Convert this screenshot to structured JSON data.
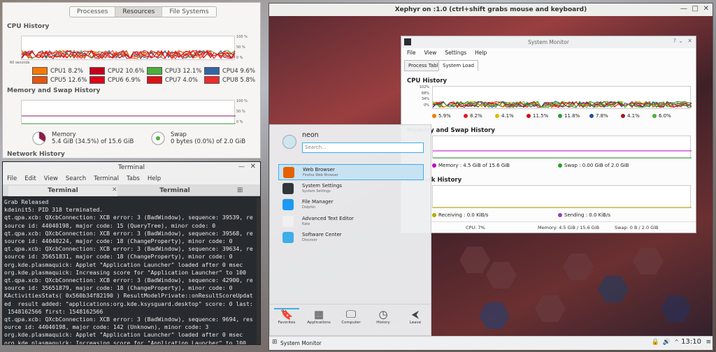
{
  "gsm": {
    "tabs": [
      "Processes",
      "Resources",
      "File Systems"
    ],
    "cpu_title": "CPU History",
    "mem_title": "Memory and Swap History",
    "net_title": "Network History",
    "axis_right": [
      "100 %",
      "50 %",
      "0 %"
    ],
    "axis_left": "60 seconds",
    "cpus": [
      {
        "label": "CPU1 8.2%",
        "color": "#f57900"
      },
      {
        "label": "CPU2 10.6%",
        "color": "#c4001c"
      },
      {
        "label": "CPU3 12.1%",
        "color": "#4caf3c"
      },
      {
        "label": "CPU4 9.6%",
        "color": "#3465a4"
      },
      {
        "label": "CPU5 12.6%",
        "color": "#e8540c"
      },
      {
        "label": "CPU6 6.9%",
        "color": "#e00018"
      },
      {
        "label": "CPU7 4.0%",
        "color": "#e01010"
      },
      {
        "label": "CPU8 5.8%",
        "color": "#ef2929"
      }
    ],
    "memory": {
      "label": "Memory",
      "value": "5.4 GiB (34.5%) of 15.6 GiB",
      "pct": 0.345
    },
    "swap": {
      "label": "Swap",
      "value": "0 bytes (0.0%) of 2.0 GiB",
      "pct": 0.0
    }
  },
  "terminal": {
    "title": "Terminal",
    "menu": [
      "File",
      "Edit",
      "View",
      "Search",
      "Terminal",
      "Tabs",
      "Help"
    ],
    "tabs": [
      "Terminal",
      "Terminal"
    ],
    "lines": "Grab Released\nkdeinit5: PID 318 terminated.\nqt.qpa.xcb: QXcbConnection: XCB error: 3 (BadWindow), sequence: 39539, re\nsource id: 44040198, major code: 15 (QueryTree), minor code: 0\nqt.qpa.xcb: QXcbConnection: XCB error: 3 (BadWindow), sequence: 39568, re\nsource id: 44040224, major code: 18 (ChangeProperty), minor code: 0\nqt.qpa.xcb: QXcbConnection: XCB error: 3 (BadWindow), sequence: 39634, re\nsource id: 35651831, major code: 18 (ChangeProperty), minor code: 0\norg.kde.plasmaquick: Applet \"Application Launcher\" loaded after 0 msec\norg.kde.plasmaquick: Increasing score for \"Application Launcher\" to 100\nqt.qpa.xcb: QXcbConnection: XCB error: 3 (BadWindow), sequence: 42900, re\nsource id: 35651879, major code: 18 (ChangeProperty), minor code: 0\nKActivitiesStats( 0x560b34f82190 ) ResultModelPrivate::onResultScoreUpdat\ned  result added: \"applications:org.kde.ksysguard.desktop\" score: 0 last:\n 1548162566 first: 1548162566\nqt.qpa.xcb: QXcbConnection: XCB error: 3 (BadWindow), sequence: 9694, res\nource id: 44040198, major code: 142 (Unknown), minor code: 3\norg.kde.plasmaquick: Applet \"Application Launcher\" loaded after 0 msec\norg.kde.plasmaquick: Increasing score for \"Application Launcher\" to 100\n|"
  },
  "xephyr": {
    "title": "Xephyr on :1.0 (ctrl+shift grabs mouse and keyboard)"
  },
  "ksm": {
    "title": "System Monitor",
    "menu": [
      "File",
      "View",
      "Settings",
      "Help"
    ],
    "tabs": [
      "Process Table",
      "System Load"
    ],
    "cpu_title": "CPU History",
    "mem_title": "Memory and Swap History",
    "net_title": "Network History",
    "cpu_axis": [
      "102%",
      "68%",
      "34%",
      "0%"
    ],
    "cpus": [
      {
        "label": "5.9%",
        "color": "#f57900"
      },
      {
        "label": "8.2%",
        "color": "#e01b24"
      },
      {
        "label": "4.1%",
        "color": "#e5b800"
      },
      {
        "label": "11.5%",
        "color": "#d01010"
      },
      {
        "label": "11.8%",
        "color": "#2ca02c"
      },
      {
        "label": "7.8%",
        "color": "#1c4fa8"
      },
      {
        "label": "4.1%",
        "color": "#a01818"
      },
      {
        "label": "6.0%",
        "color": "#4caf3c"
      }
    ],
    "mem_legend": [
      {
        "label": "Memory : 4.5 GiB of 15.6 GiB",
        "color": "#c000c0"
      },
      {
        "label": "Swap : 0.00 GiB of 2.0 GiB",
        "color": "#2ca02c"
      }
    ],
    "net_legend": [
      {
        "label": "Receiving : 0.0 KiB/s",
        "color": "#b8a800"
      },
      {
        "label": "Sending : 0.0 KiB/s",
        "color": "#9040c0"
      }
    ],
    "status": {
      "cpu": "CPU: 7%",
      "mem": "Memory: 4.5 GiB / 15.6 GiB",
      "swap": "Swap: 0 B / 2.0 GiB"
    }
  },
  "launcher": {
    "user": "neon",
    "search_placeholder": "Search...",
    "items": [
      {
        "name": "Web Browser",
        "desc": "Firefox Web Browser",
        "color": "#e66000"
      },
      {
        "name": "System Settings",
        "desc": "System Settings",
        "color": "#31363b"
      },
      {
        "name": "File Manager",
        "desc": "Dolphin",
        "color": "#1d99f3"
      },
      {
        "name": "Advanced Text Editor",
        "desc": "Kate",
        "color": "#f0f0f0"
      },
      {
        "name": "Software Center",
        "desc": "Discover",
        "color": "#3daee9"
      }
    ],
    "buttons": [
      {
        "label": "Favorites",
        "glyph": "🔖"
      },
      {
        "label": "Applications",
        "glyph": "▦"
      },
      {
        "label": "Computer",
        "glyph": "🖵"
      },
      {
        "label": "History",
        "glyph": "◷"
      },
      {
        "label": "Leave",
        "glyph": "⮜"
      }
    ]
  },
  "panel": {
    "task": "System Monitor",
    "clock": "13:10"
  }
}
